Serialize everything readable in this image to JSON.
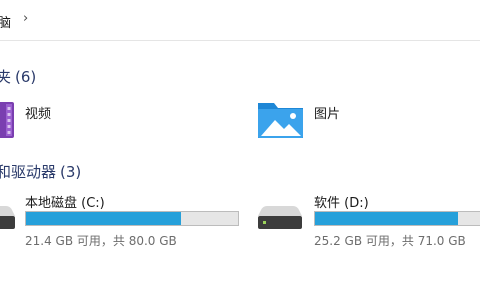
{
  "address": {
    "breadcrumb": "脑",
    "separator": "›"
  },
  "sections": {
    "folders": {
      "title": "夹",
      "count": "(6)"
    },
    "drives": {
      "title": "和驱动器",
      "count": "(3)"
    }
  },
  "folders": [
    {
      "label": "视频",
      "icon": "video-folder-icon"
    },
    {
      "label": "图片",
      "icon": "pictures-folder-icon"
    }
  ],
  "drives": [
    {
      "label": "本地磁盘 (C:)",
      "free_text": "21.4 GB 可用，共 80.0 GB",
      "used_fraction": 0.7325,
      "bar_color": "#26a0da",
      "icon": "hard-drive-icon"
    },
    {
      "label": "软件 (D:)",
      "free_text": "25.2 GB 可用，共 71.0 GB",
      "used_fraction": 0.645,
      "bar_color": "#26a0da",
      "icon": "hard-drive-icon"
    }
  ]
}
